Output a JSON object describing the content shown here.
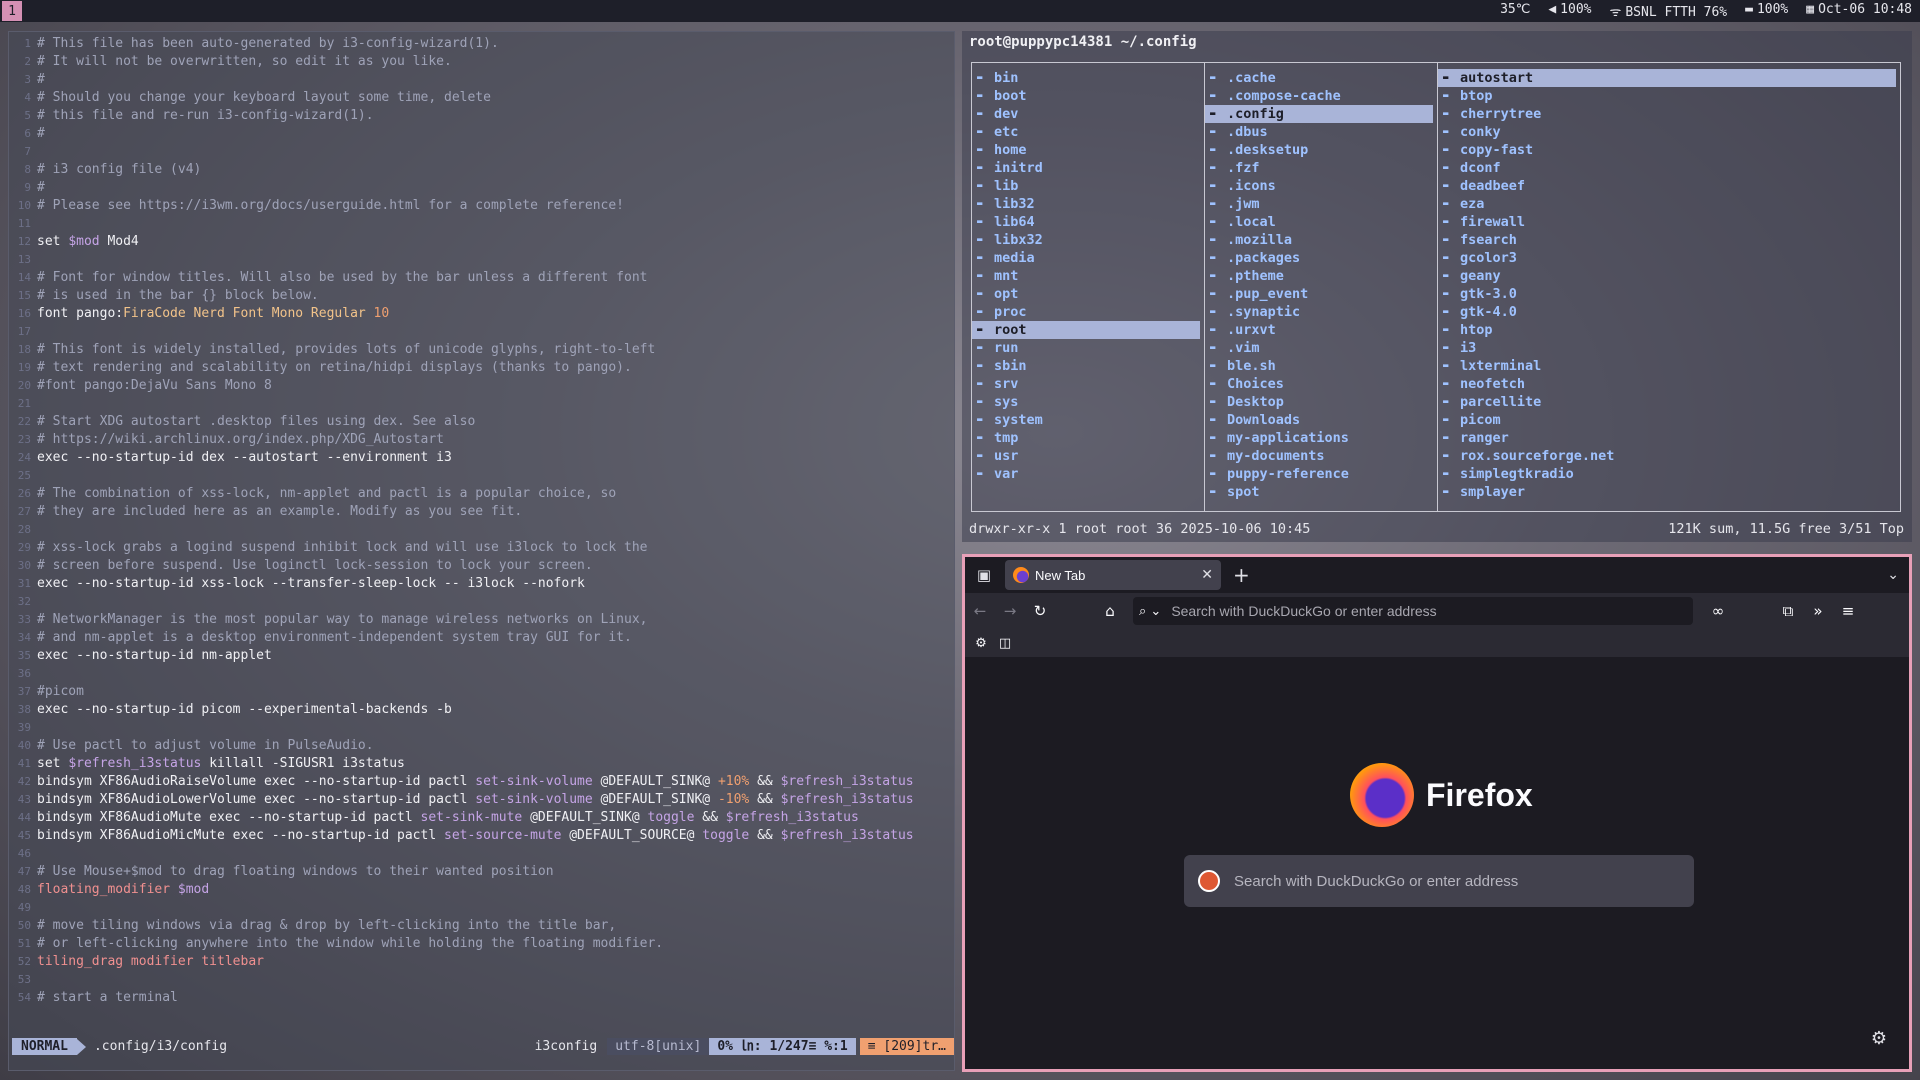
{
  "topbar": {
    "workspace": "1",
    "temp": "35℃",
    "volume": "100%",
    "wifi": "BSNL FTTH 76%",
    "battery": "100%",
    "datetime": "Oct-06 10:48"
  },
  "vim": {
    "lines": [
      [
        {
          "t": "# This file has been auto-generated by i3-config-wizard(1).",
          "c": "cc"
        }
      ],
      [
        {
          "t": "# It will not be overwritten, so edit it as you like.",
          "c": "cc"
        }
      ],
      [
        {
          "t": "#",
          "c": "cc"
        }
      ],
      [
        {
          "t": "# Should you change your keyboard layout some time, delete",
          "c": "cc"
        }
      ],
      [
        {
          "t": "# this file and re-run i3-config-wizard(1).",
          "c": "cc"
        }
      ],
      [
        {
          "t": "#",
          "c": "cc"
        }
      ],
      [
        {
          "t": "",
          "c": "cc"
        }
      ],
      [
        {
          "t": "# i3 config file (v4)",
          "c": "cc"
        }
      ],
      [
        {
          "t": "#",
          "c": "cc"
        }
      ],
      [
        {
          "t": "# Please see https://i3wm.org/docs/userguide.html for a complete reference!",
          "c": "cc"
        }
      ],
      [
        {
          "t": "",
          "c": "cc"
        }
      ],
      [
        {
          "t": "set ",
          "c": "kw"
        },
        {
          "t": "$mod",
          "c": "var"
        },
        {
          "t": " Mod4",
          "c": "kw"
        }
      ],
      [
        {
          "t": "",
          "c": "cc"
        }
      ],
      [
        {
          "t": "# Font for window titles. Will also be used by the bar unless a different font",
          "c": "cc"
        }
      ],
      [
        {
          "t": "# is used in the bar {} block below.",
          "c": "cc"
        }
      ],
      [
        {
          "t": "font pango:",
          "c": "kw"
        },
        {
          "t": "FiraCode Nerd Font Mono Regular ",
          "c": "str"
        },
        {
          "t": "10",
          "c": "num"
        }
      ],
      [
        {
          "t": "",
          "c": "cc"
        }
      ],
      [
        {
          "t": "# This font is widely installed, provides lots of unicode glyphs, right-to-left",
          "c": "cc"
        }
      ],
      [
        {
          "t": "# text rendering and scalability on retina/hidpi displays (thanks to pango).",
          "c": "cc"
        }
      ],
      [
        {
          "t": "#font pango:DejaVu Sans Mono 8",
          "c": "cc"
        }
      ],
      [
        {
          "t": "",
          "c": "cc"
        }
      ],
      [
        {
          "t": "# Start XDG autostart .desktop files using dex. See also",
          "c": "cc"
        }
      ],
      [
        {
          "t": "# https://wiki.archlinux.org/index.php/XDG_Autostart",
          "c": "cc"
        }
      ],
      [
        {
          "t": "exec --no-startup-id dex --autostart --environment i3",
          "c": "kw"
        }
      ],
      [
        {
          "t": "",
          "c": "cc"
        }
      ],
      [
        {
          "t": "# The combination of xss-lock, nm-applet and pactl is a popular choice, so",
          "c": "cc"
        }
      ],
      [
        {
          "t": "# they are included here as an example. Modify as you see fit.",
          "c": "cc"
        }
      ],
      [
        {
          "t": "",
          "c": "cc"
        }
      ],
      [
        {
          "t": "# xss-lock grabs a logind suspend inhibit lock and will use i3lock to lock the",
          "c": "cc"
        }
      ],
      [
        {
          "t": "# screen before suspend. Use loginctl lock-session to lock your screen.",
          "c": "cc"
        }
      ],
      [
        {
          "t": "exec --no-startup-id xss-lock --transfer-sleep-lock -- i3lock --nofork",
          "c": "kw"
        }
      ],
      [
        {
          "t": "",
          "c": "cc"
        }
      ],
      [
        {
          "t": "# NetworkManager is the most popular way to manage wireless networks on Linux,",
          "c": "cc"
        }
      ],
      [
        {
          "t": "# and nm-applet is a desktop environment-independent system tray GUI for it.",
          "c": "cc"
        }
      ],
      [
        {
          "t": "exec --no-startup-id nm-applet",
          "c": "kw"
        }
      ],
      [
        {
          "t": "",
          "c": "cc"
        }
      ],
      [
        {
          "t": "#picom",
          "c": "cc"
        }
      ],
      [
        {
          "t": "exec --no-startup-id picom --experimental-backends -b",
          "c": "kw"
        }
      ],
      [
        {
          "t": "",
          "c": "cc"
        }
      ],
      [
        {
          "t": "# Use pactl to adjust volume in PulseAudio.",
          "c": "cc"
        }
      ],
      [
        {
          "t": "set ",
          "c": "kw"
        },
        {
          "t": "$refresh_i3status",
          "c": "var"
        },
        {
          "t": " killall -SIGUSR1 i3status",
          "c": "kw"
        }
      ],
      [
        {
          "t": "bindsym XF86AudioRaiseVolume exec --no-startup-id pactl ",
          "c": "kw"
        },
        {
          "t": "set-sink-volume",
          "c": "var"
        },
        {
          "t": " @DEFAULT_SINK@ ",
          "c": "kw"
        },
        {
          "t": "+10%",
          "c": "num"
        },
        {
          "t": " && ",
          "c": "kw"
        },
        {
          "t": "$refresh_i3status",
          "c": "var"
        }
      ],
      [
        {
          "t": "bindsym XF86AudioLowerVolume exec --no-startup-id pactl ",
          "c": "kw"
        },
        {
          "t": "set-sink-volume",
          "c": "var"
        },
        {
          "t": " @DEFAULT_SINK@ ",
          "c": "kw"
        },
        {
          "t": "-10%",
          "c": "num"
        },
        {
          "t": " && ",
          "c": "kw"
        },
        {
          "t": "$refresh_i3status",
          "c": "var"
        }
      ],
      [
        {
          "t": "bindsym XF86AudioMute exec --no-startup-id pactl ",
          "c": "kw"
        },
        {
          "t": "set-sink-mute",
          "c": "var"
        },
        {
          "t": " @DEFAULT_SINK@ ",
          "c": "kw"
        },
        {
          "t": "toggle",
          "c": "var"
        },
        {
          "t": " && ",
          "c": "kw"
        },
        {
          "t": "$refresh_i3status",
          "c": "var"
        }
      ],
      [
        {
          "t": "bindsym XF86AudioMicMute exec --no-startup-id pactl ",
          "c": "kw"
        },
        {
          "t": "set-source-mute",
          "c": "var"
        },
        {
          "t": " @DEFAULT_SOURCE@ ",
          "c": "kw"
        },
        {
          "t": "toggle",
          "c": "var"
        },
        {
          "t": " && ",
          "c": "kw"
        },
        {
          "t": "$refresh_i3status",
          "c": "var"
        }
      ],
      [
        {
          "t": "",
          "c": "cc"
        }
      ],
      [
        {
          "t": "# Use Mouse+$mod to drag floating windows to their wanted position",
          "c": "cc"
        }
      ],
      [
        {
          "t": "floating_modifier ",
          "c": "red"
        },
        {
          "t": "$mod",
          "c": "var"
        }
      ],
      [
        {
          "t": "",
          "c": "cc"
        }
      ],
      [
        {
          "t": "# move tiling windows via drag & drop by left-clicking into the title bar,",
          "c": "cc"
        }
      ],
      [
        {
          "t": "# or left-clicking anywhere into the window while holding the floating modifier.",
          "c": "cc"
        }
      ],
      [
        {
          "t": "tiling_drag modifier titlebar",
          "c": "red"
        }
      ],
      [
        {
          "t": "",
          "c": "cc"
        }
      ],
      [
        {
          "t": "# start a terminal",
          "c": "cc"
        }
      ]
    ],
    "status": {
      "mode": "NORMAL",
      "file": ".config/i3/config",
      "filetype": "i3config",
      "encoding": "utf-8[unix]",
      "position": "0% ㏑: 1/247≡ %:1",
      "warning": "≡ [209]tr…"
    }
  },
  "ranger": {
    "title": "root@puppypc14381 ~/.config",
    "col1": [
      {
        "name": "bin"
      },
      {
        "name": "boot"
      },
      {
        "name": "dev"
      },
      {
        "name": "etc"
      },
      {
        "name": "home"
      },
      {
        "name": "initrd"
      },
      {
        "name": "lib"
      },
      {
        "name": "lib32"
      },
      {
        "name": "lib64"
      },
      {
        "name": "libx32"
      },
      {
        "name": "media"
      },
      {
        "name": "mnt"
      },
      {
        "name": "opt"
      },
      {
        "name": "proc"
      },
      {
        "name": "root",
        "sel": true
      },
      {
        "name": "run"
      },
      {
        "name": "sbin"
      },
      {
        "name": "srv"
      },
      {
        "name": "sys"
      },
      {
        "name": "system"
      },
      {
        "name": "tmp"
      },
      {
        "name": "usr"
      },
      {
        "name": "var"
      }
    ],
    "col2": [
      {
        "name": ".cache",
        "f": true
      },
      {
        "name": ".compose-cache",
        "f": true
      },
      {
        "name": ".config",
        "sel": true
      },
      {
        "name": ".dbus",
        "f": true
      },
      {
        "name": ".desksetup",
        "f": true
      },
      {
        "name": ".fzf",
        "f": true
      },
      {
        "name": ".icons",
        "f": true
      },
      {
        "name": ".jwm",
        "f": true
      },
      {
        "name": ".local",
        "f": true
      },
      {
        "name": ".mozilla",
        "f": true
      },
      {
        "name": ".packages",
        "f": true
      },
      {
        "name": ".ptheme",
        "f": true
      },
      {
        "name": ".pup_event",
        "f": true
      },
      {
        "name": ".synaptic",
        "f": true
      },
      {
        "name": ".urxvt",
        "f": true
      },
      {
        "name": ".vim",
        "f": true
      },
      {
        "name": "ble.sh",
        "f": true
      },
      {
        "name": "Choices",
        "f": true
      },
      {
        "name": "Desktop",
        "f": true
      },
      {
        "name": "Downloads",
        "f": true
      },
      {
        "name": "my-applications",
        "f": true
      },
      {
        "name": "my-documents",
        "f": true
      },
      {
        "name": "puppy-reference",
        "f": true
      },
      {
        "name": "spot",
        "f": true
      }
    ],
    "col3": [
      {
        "name": "autostart",
        "sel": true
      },
      {
        "name": "btop"
      },
      {
        "name": "cherrytree"
      },
      {
        "name": "conky"
      },
      {
        "name": "copy-fast"
      },
      {
        "name": "dconf"
      },
      {
        "name": "deadbeef"
      },
      {
        "name": "eza"
      },
      {
        "name": "firewall"
      },
      {
        "name": "fsearch"
      },
      {
        "name": "gcolor3"
      },
      {
        "name": "geany"
      },
      {
        "name": "gtk-3.0"
      },
      {
        "name": "gtk-4.0"
      },
      {
        "name": "htop"
      },
      {
        "name": "i3"
      },
      {
        "name": "lxterminal"
      },
      {
        "name": "neofetch"
      },
      {
        "name": "parcellite"
      },
      {
        "name": "picom"
      },
      {
        "name": "ranger"
      },
      {
        "name": "rox.sourceforge.net"
      },
      {
        "name": "simplegtkradio"
      },
      {
        "name": "smplayer"
      }
    ],
    "footer_left": "drwxr-xr-x 1 root root 36 2025-10-06 10:45",
    "footer_right": "121K sum, 11.5G free  3/51  Top"
  },
  "firefox": {
    "tab_title": "New Tab",
    "url_placeholder": "Search with DuckDuckGo or enter address",
    "brand": "Firefox",
    "search_placeholder": "Search with DuckDuckGo or enter address"
  },
  "colors": {
    "accent_pink": "#e8a0b8",
    "selection": "#a9b4d8",
    "dir_blue": "#9fc2ff"
  }
}
